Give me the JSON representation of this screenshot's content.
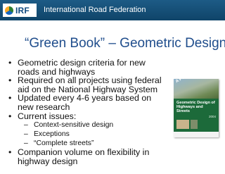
{
  "header": {
    "logo_text": "IRF",
    "org_name": "International Road Federation"
  },
  "slide": {
    "title": "“Green Book” – Geometric Design",
    "bullets": [
      {
        "lines": [
          "Geometric design criteria for new",
          "roads and highways"
        ]
      },
      {
        "lines": [
          "Required on all projects using federal",
          "aid on the National Highway System"
        ]
      },
      {
        "lines": [
          "Updated every 4-6 years based on",
          "new research"
        ]
      },
      {
        "lines": [
          "Current issues:"
        ]
      }
    ],
    "sub_bullets": [
      "Context-sensitive design",
      "Exceptions",
      "“Complete streets”"
    ],
    "last_bullet": {
      "lines": [
        "Companion volume on flexibility in",
        "highway design"
      ]
    }
  },
  "book_cover": {
    "ribbon": "A POLICY ON",
    "title_lines": [
      "Geometric Design of",
      "Highways and Streets"
    ],
    "year": "2004"
  },
  "colors": {
    "header": "#174f79",
    "title": "#1f4d8c",
    "book_green": "#1c6a3a"
  }
}
